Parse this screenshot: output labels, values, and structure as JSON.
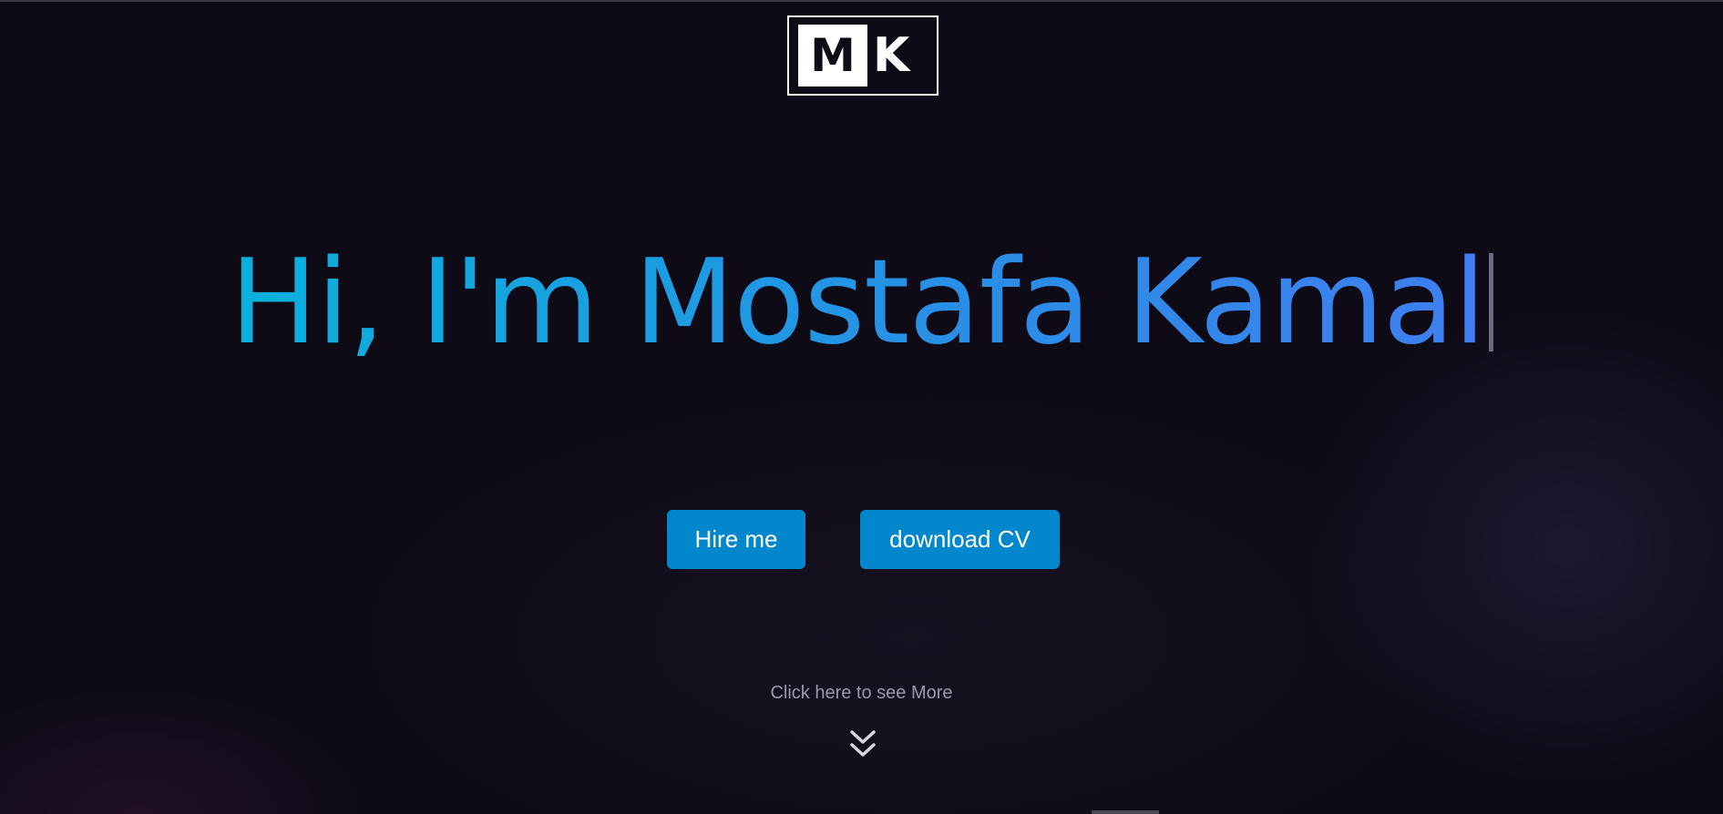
{
  "logo": {
    "letter1": "M",
    "letter2": "K"
  },
  "hero": {
    "title": "Hi, I'm Mostafa Kamal"
  },
  "buttons": {
    "hire_label": "Hire me",
    "cv_label": "download CV"
  },
  "scroll_prompt": {
    "text": "Click here to see More",
    "icon": "chevron-double-down-icon"
  },
  "colors": {
    "background": "#0e0b17",
    "button": "#0387cc",
    "title_gradient_start": "#0ab0dc",
    "title_gradient_end": "#3f7ef0"
  }
}
